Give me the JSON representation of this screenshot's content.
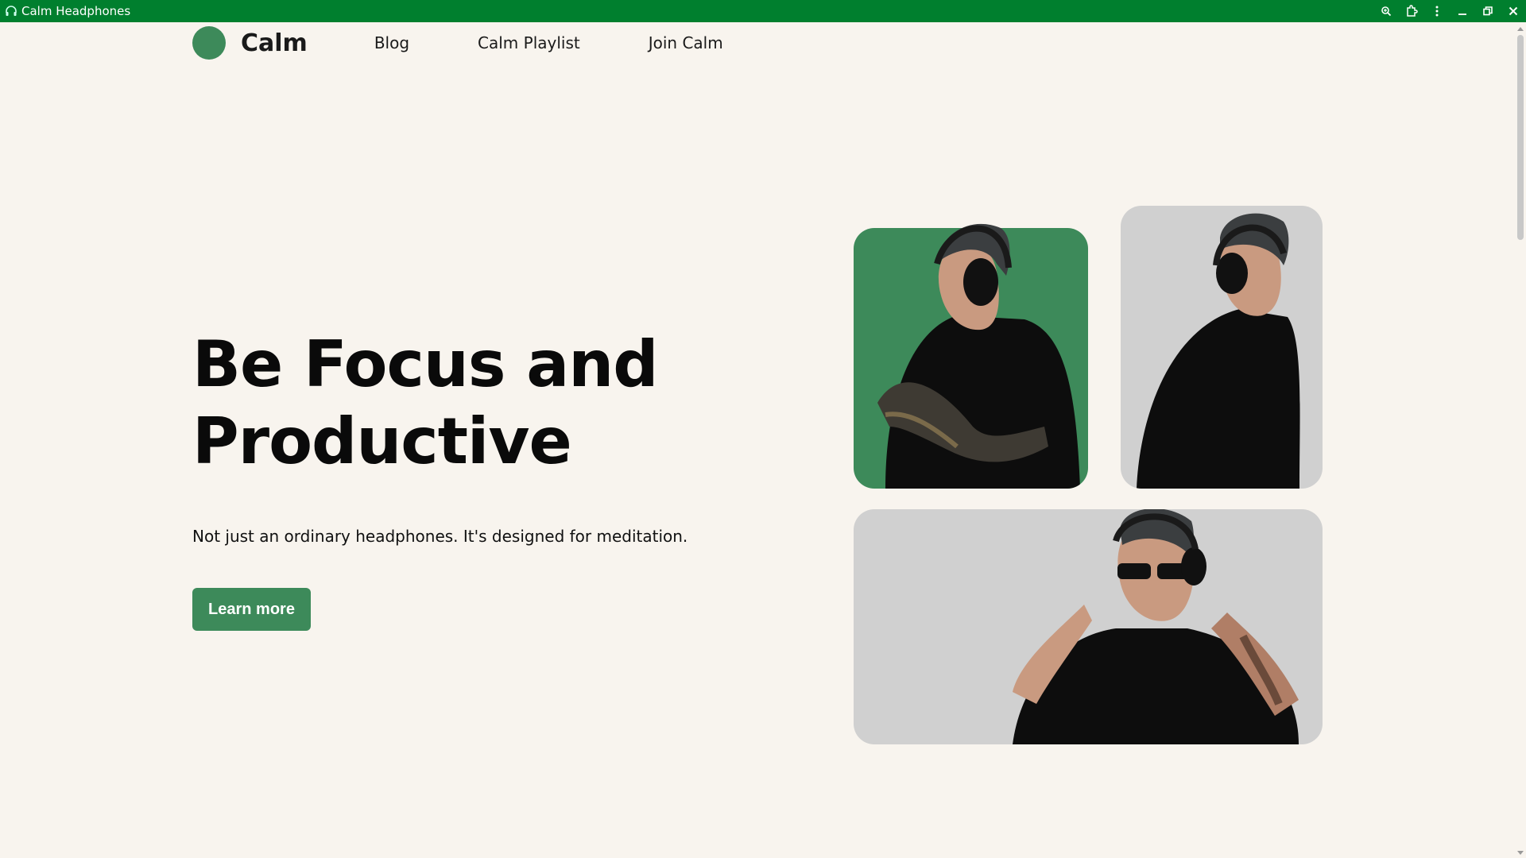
{
  "window": {
    "title": "Calm Headphones",
    "icon": "headphones-icon",
    "controls": [
      "zoom-icon",
      "extensions-icon",
      "menu-icon",
      "minimize-icon",
      "restore-icon",
      "close-icon"
    ],
    "titlebar_color": "#007f2e"
  },
  "nav": {
    "brand": "Calm",
    "links": [
      "Blog",
      "Calm Playlist",
      "Join Calm"
    ]
  },
  "hero": {
    "title_line1": "Be Focus and",
    "title_line2": "Productive",
    "subtitle": "Not just an ordinary headphones. It's designed for meditation.",
    "cta_label": "Learn more"
  },
  "colors": {
    "accent": "#3d8a5a",
    "page_background": "#f8f4ee",
    "photo_background": "#d0d0d0"
  },
  "photos": [
    {
      "name": "man-arms-crossed-headphones",
      "background": "green"
    },
    {
      "name": "man-looking-down-headphones",
      "background": "gray"
    },
    {
      "name": "man-sunglasses-headphones",
      "background": "gray"
    }
  ]
}
